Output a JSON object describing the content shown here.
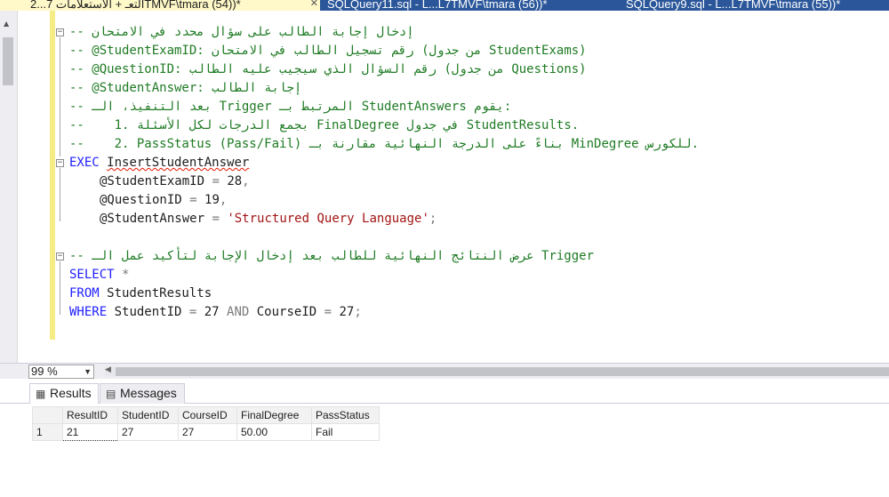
{
  "tabs": [
    {
      "label": "2...التعـ + الاستعلامات 7TMVF\\tmara (54))*",
      "active": true
    },
    {
      "label": "SQLQuery11.sql - L...L7TMVF\\tmara (56))*",
      "active": false
    },
    {
      "label": "SQLQuery9.sql - L...L7TMVF\\tmara (55))*",
      "active": false
    }
  ],
  "editor": {
    "comment1": "-- إدخال إجابة الطالب على سؤال محدد في الامتحان",
    "comment2": "-- @StudentExamID: رقم تسجيل الطالب في الامتحان (من جدول StudentExams)",
    "comment3": "-- @QuestionID: رقم السؤال الذي سيجيب عليه الطالب (من جدول Questions)",
    "comment4": "-- @StudentAnswer: إجابة الطالب",
    "comment5": "-- بعد التنفيذ، الـ Trigger المرتبط بـ StudentAnswers يقوم:",
    "comment6": "--    1. بجمع الدرجات لكل الأسئلة FinalDegree في جدول StudentResults.",
    "comment7": "--    2. PassStatus (Pass/Fail) بناءً على الدرجة النهائية مقارنة بـ MinDegree للكورس.",
    "exec_kw": "EXEC",
    "exec_proc": "InsertStudentAnswer",
    "param1_name": "@StudentExamID",
    "param1_eq": " = ",
    "param1_val": "28",
    "param1_end": ",",
    "param2_name": "@QuestionID",
    "param2_eq": " = ",
    "param2_val": "19",
    "param2_end": ",",
    "param3_name": "@StudentAnswer",
    "param3_eq": " = ",
    "param3_val": "'Structured Query Language'",
    "param3_end": ";",
    "comment8": "-- عرض النتائج النهائية للطالب بعد إدخال الإجابة لتأكيد عمل الـ Trigger",
    "select_kw": "SELECT",
    "select_star": " *",
    "from_kw": "FROM",
    "from_table": " StudentResults",
    "where_kw": "WHERE",
    "where_col1": " StudentID ",
    "where_eq1": "=",
    "where_val1": " 27 ",
    "and_kw": "AND",
    "where_col2": " CourseID ",
    "where_eq2": "=",
    "where_val2": " 27",
    "where_end": ";"
  },
  "zoom": {
    "value": "99 %"
  },
  "results_tabs": [
    {
      "label": "Results",
      "icon": "grid-icon"
    },
    {
      "label": "Messages",
      "icon": "messages-icon"
    }
  ],
  "results": {
    "columns": [
      "ResultID",
      "StudentID",
      "CourseID",
      "FinalDegree",
      "PassStatus"
    ],
    "rows": [
      {
        "rownum": "1",
        "cells": [
          "21",
          "27",
          "27",
          "50.00",
          "Fail"
        ]
      }
    ]
  },
  "colors": {
    "comment": "#1f7b24",
    "keyword": "#1f1fff",
    "string": "#a31515",
    "tab_strip": "#2b579a",
    "active_tab": "#fff8c8",
    "margin_marker": "#f6ec86"
  }
}
